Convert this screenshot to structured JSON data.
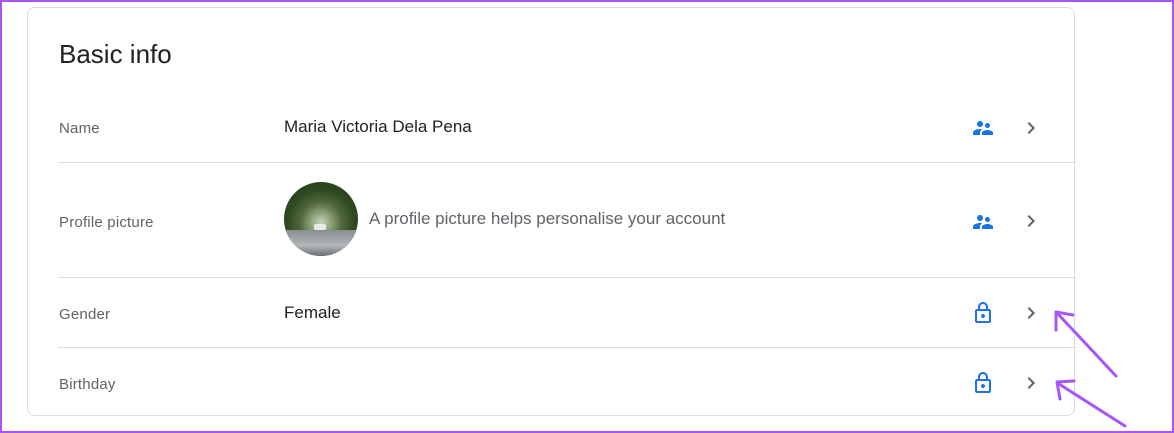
{
  "card": {
    "title": "Basic info"
  },
  "rows": [
    {
      "label": "Name",
      "value": "Maria Victoria Dela Pena",
      "visibility_icon": "people-icon"
    },
    {
      "label": "Profile picture",
      "value": "A profile picture helps personalise your account",
      "visibility_icon": "people-icon"
    },
    {
      "label": "Gender",
      "value": "Female",
      "visibility_icon": "lock-icon"
    },
    {
      "label": "Birthday",
      "value": "",
      "visibility_icon": "lock-icon"
    }
  ],
  "colors": {
    "accent_blue": "#1a73e8",
    "annotation_purple": "#a855f7",
    "chevron_gray": "#5f6368"
  }
}
